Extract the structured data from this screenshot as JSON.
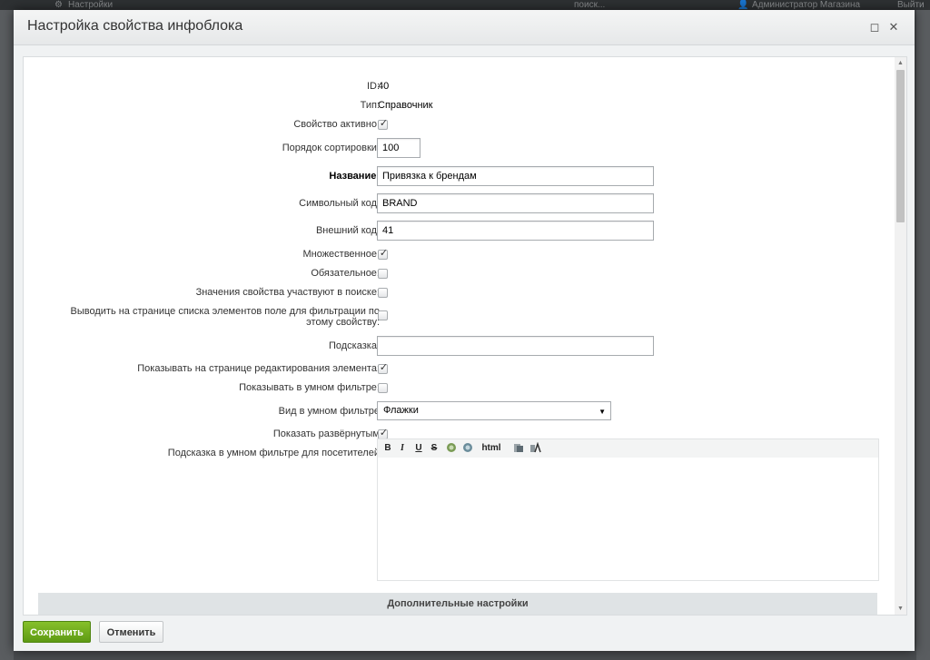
{
  "background": {
    "topbar_settings": "Настройки",
    "topbar_search": "поиск...",
    "topbar_user": "Администратор Магазина",
    "topbar_logout": "Выйти"
  },
  "dialog": {
    "title": "Настройка свойства инфоблока",
    "expand_icon": "maximize-icon",
    "close_icon": "close-icon"
  },
  "form": {
    "id": {
      "label": "ID:",
      "value": "40"
    },
    "type": {
      "label": "Тип:",
      "value": "Справочник"
    },
    "active": {
      "label": "Свойство активно:",
      "checked": true
    },
    "sort": {
      "label": "Порядок сортировки:",
      "value": "100"
    },
    "name": {
      "label": "Название:",
      "value": "Привязка к брендам"
    },
    "code": {
      "label": "Символьный код:",
      "value": "BRAND"
    },
    "xml_id": {
      "label": "Внешний код:",
      "value": "41"
    },
    "multiple": {
      "label": "Множественное:",
      "checked": true
    },
    "required": {
      "label": "Обязательное:",
      "checked": false
    },
    "searchable": {
      "label": "Значения свойства участвуют в поиске:",
      "checked": false
    },
    "filtrable": {
      "label": "Выводить на странице списка элементов поле для фильтрации по этому свойству:",
      "checked": false
    },
    "hint": {
      "label": "Подсказка:",
      "value": ""
    },
    "show_on_edit": {
      "label": "Показывать на странице редактирования элемента:",
      "checked": true
    },
    "smart_filter": {
      "label": "Показывать в умном фильтре:",
      "checked": false
    },
    "smart_filter_view": {
      "label": "Вид в умном фильтре",
      "value": "Флажки"
    },
    "show_expanded": {
      "label": "Показать развёрнутым",
      "checked": true
    },
    "filter_hint": {
      "label": "Подсказка в умном фильтре для посетителей"
    }
  },
  "editor_toolbar": {
    "bold": "B",
    "italic": "I",
    "underline": "U",
    "strike": "S",
    "html": "html"
  },
  "advanced": {
    "label": "Дополнительные настройки"
  },
  "footer": {
    "save": "Сохранить",
    "cancel": "Отменить"
  },
  "colors": {
    "save_button": "#6aa71b",
    "header_bg": "#eceeef"
  }
}
